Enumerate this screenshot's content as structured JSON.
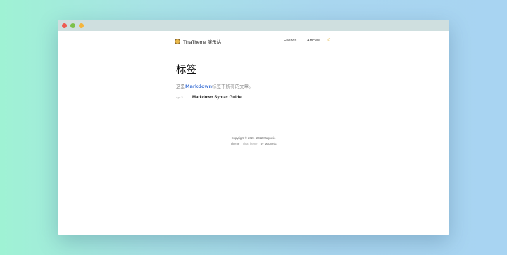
{
  "nav": {
    "site_title": "TinaTheme 演示站",
    "links": [
      "Friends",
      "Articles"
    ],
    "theme_icon": "moon-icon"
  },
  "main": {
    "title": "标签",
    "desc_prefix": "这是",
    "desc_tag": "Markdown",
    "desc_suffix": "标签下所有的文章。",
    "posts": [
      {
        "date": "Apr 3",
        "title": "Markdown Syntax Guide"
      }
    ]
  },
  "footer": {
    "copyright": "Copyright © 2021- 2022 Magnetic",
    "theme_label": "Theme",
    "theme_name": "TinaTheme",
    "by": "By Magnetic"
  },
  "colors": {
    "accent": "#4a7bd8",
    "window_bg": "#ffffff",
    "titlebar": "#cfdfdf"
  }
}
